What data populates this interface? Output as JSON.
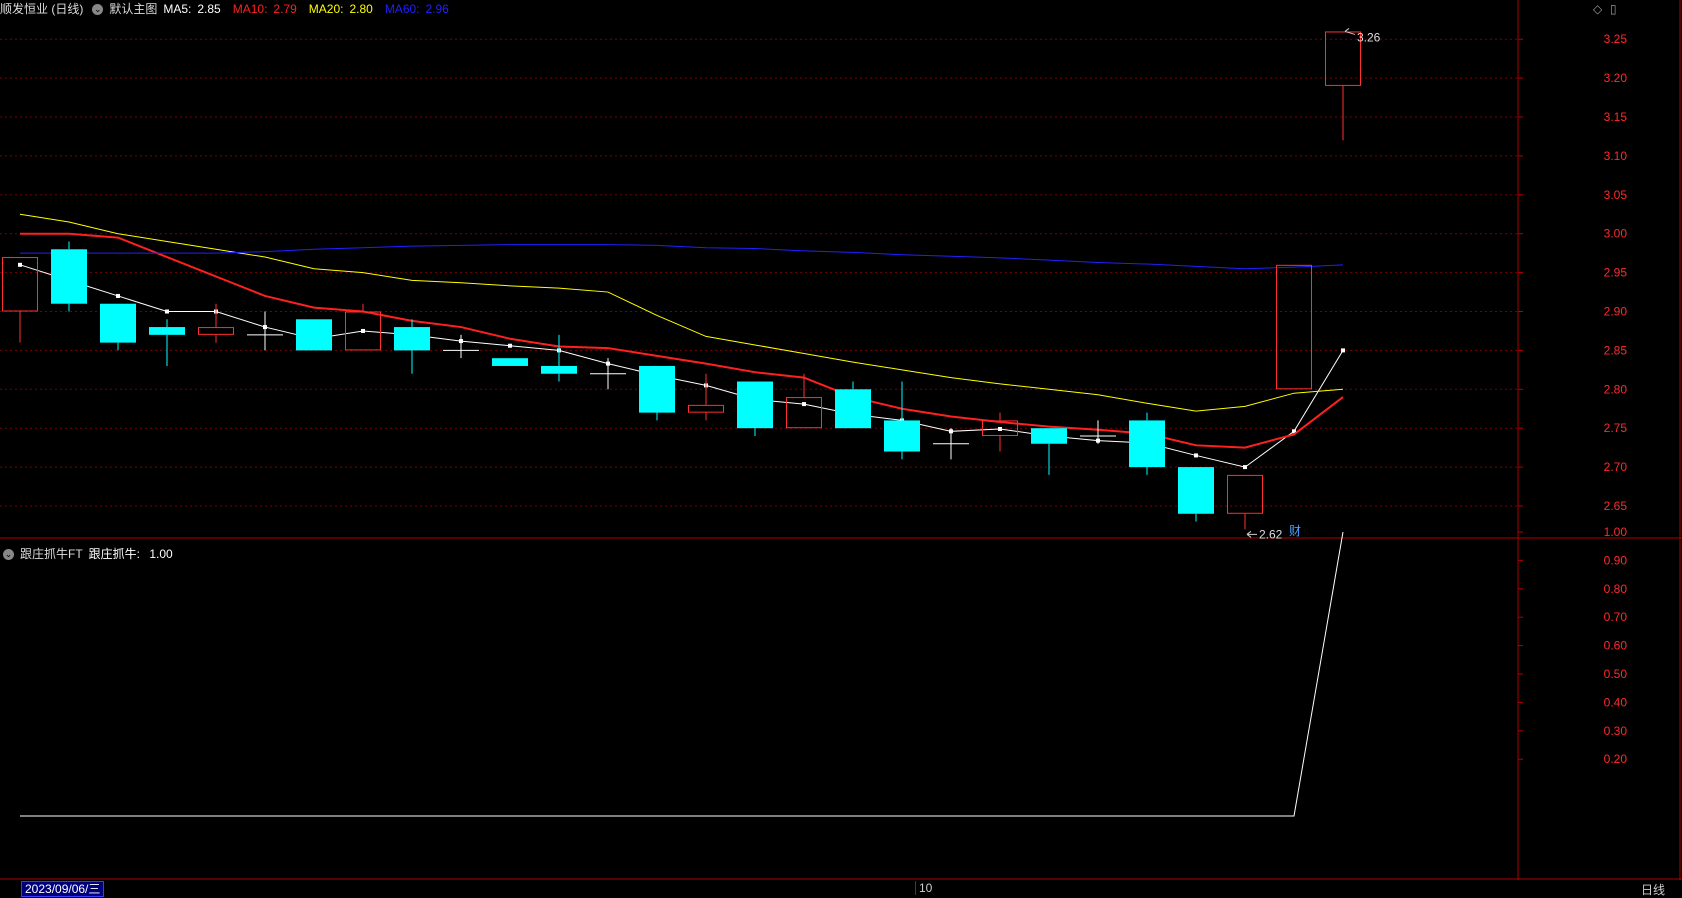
{
  "header": {
    "stock": "顺发恒业 (日线)",
    "main_label": "默认主图",
    "ma": [
      {
        "label": "MA5:",
        "value": "2.85",
        "color": "#ffffff"
      },
      {
        "label": "MA10:",
        "value": "2.79",
        "color": "#ff2020"
      },
      {
        "label": "MA20:",
        "value": "2.80",
        "color": "#ffff00"
      },
      {
        "label": "MA60:",
        "value": "2.96",
        "color": "#2020ff"
      }
    ]
  },
  "sub_header": {
    "indicator": "跟庄抓牛FT",
    "line_label": "跟庄抓牛:",
    "line_value": "1.00"
  },
  "bottom": {
    "date": "2023/09/06/三",
    "month_marker": "10",
    "period": "日线"
  },
  "annotations": {
    "high": "3.26",
    "low": "2.62",
    "fin_marker": "财"
  },
  "chart_data": [
    {
      "type": "candlestick",
      "y_ticks": [
        "3.25",
        "3.20",
        "3.15",
        "3.10",
        "3.05",
        "3.00",
        "2.95",
        "2.90",
        "2.85",
        "2.80",
        "2.75",
        "2.70",
        "2.65"
      ],
      "ylim": [
        2.605,
        3.285
      ],
      "colors": {
        "up": "#ff3030",
        "down": "#00ffff",
        "doji": "#ffffff"
      },
      "candles": [
        [
          2.9,
          2.97,
          2.97,
          2.86
        ],
        [
          2.98,
          2.91,
          2.99,
          2.9
        ],
        [
          2.91,
          2.86,
          2.91,
          2.85
        ],
        [
          2.88,
          2.87,
          2.89,
          2.83
        ],
        [
          2.87,
          2.88,
          2.91,
          2.86
        ],
        [
          2.87,
          2.87,
          2.9,
          2.85
        ],
        [
          2.89,
          2.85,
          2.89,
          2.85
        ],
        [
          2.85,
          2.9,
          2.91,
          2.85
        ],
        [
          2.88,
          2.85,
          2.89,
          2.82
        ],
        [
          2.85,
          2.85,
          2.87,
          2.84
        ],
        [
          2.84,
          2.83,
          2.84,
          2.83
        ],
        [
          2.83,
          2.82,
          2.87,
          2.81
        ],
        [
          2.82,
          2.82,
          2.84,
          2.8
        ],
        [
          2.83,
          2.77,
          2.83,
          2.76
        ],
        [
          2.77,
          2.78,
          2.82,
          2.76
        ],
        [
          2.81,
          2.75,
          2.81,
          2.74
        ],
        [
          2.75,
          2.79,
          2.82,
          2.75
        ],
        [
          2.8,
          2.75,
          2.81,
          2.75
        ],
        [
          2.76,
          2.72,
          2.81,
          2.71
        ],
        [
          2.73,
          2.73,
          2.75,
          2.71
        ],
        [
          2.74,
          2.76,
          2.77,
          2.72
        ],
        [
          2.75,
          2.73,
          2.75,
          2.69
        ],
        [
          2.74,
          2.74,
          2.76,
          2.73
        ],
        [
          2.76,
          2.7,
          2.77,
          2.69
        ],
        [
          2.7,
          2.64,
          2.7,
          2.63
        ],
        [
          2.64,
          2.69,
          2.69,
          2.62
        ],
        [
          2.8,
          2.96,
          2.96,
          2.8
        ],
        [
          3.19,
          3.26,
          3.26,
          3.12
        ]
      ],
      "ma": [
        {
          "name": "MA5",
          "color": "#ffffff",
          "values": [
            2.96,
            2.94,
            2.92,
            2.9,
            2.9,
            2.88,
            2.865,
            2.875,
            2.87,
            2.862,
            2.856,
            2.85,
            2.833,
            2.818,
            2.805,
            2.787,
            2.781,
            2.768,
            2.76,
            2.746,
            2.749,
            2.74,
            2.734,
            2.731,
            2.715,
            2.7,
            2.746,
            2.85
          ]
        },
        {
          "name": "MA10",
          "color": "#ff2020",
          "values": [
            3.0,
            3.0,
            2.995,
            2.97,
            2.945,
            2.92,
            2.905,
            2.9,
            2.888,
            2.88,
            2.865,
            2.855,
            2.853,
            2.843,
            2.833,
            2.822,
            2.815,
            2.79,
            2.775,
            2.765,
            2.758,
            2.752,
            2.748,
            2.743,
            2.728,
            2.725,
            2.742,
            2.79
          ]
        },
        {
          "name": "MA20",
          "color": "#ffff00",
          "values": [
            3.025,
            3.015,
            3.0,
            2.99,
            2.98,
            2.97,
            2.955,
            2.95,
            2.94,
            2.937,
            2.933,
            2.93,
            2.925,
            2.895,
            2.868,
            2.857,
            2.846,
            2.835,
            2.825,
            2.815,
            2.807,
            2.8,
            2.793,
            2.782,
            2.772,
            2.778,
            2.795,
            2.8
          ]
        },
        {
          "name": "MA60",
          "color": "#2020ff",
          "values": [
            2.975,
            2.975,
            2.975,
            2.975,
            2.975,
            2.977,
            2.98,
            2.982,
            2.984,
            2.985,
            2.986,
            2.986,
            2.986,
            2.985,
            2.982,
            2.981,
            2.978,
            2.976,
            2.973,
            2.971,
            2.969,
            2.966,
            2.963,
            2.961,
            2.958,
            2.955,
            2.957,
            2.96
          ]
        }
      ]
    },
    {
      "type": "line",
      "title": "跟庄抓牛FT",
      "series": [
        {
          "name": "跟庄抓牛",
          "color": "#ffffff",
          "values": [
            0,
            0,
            0,
            0,
            0,
            0,
            0,
            0,
            0,
            0,
            0,
            0,
            0,
            0,
            0,
            0,
            0,
            0,
            0,
            0,
            0,
            0,
            0,
            0,
            0,
            0,
            0,
            1.0
          ]
        }
      ],
      "y_ticks": [
        "1.00",
        "0.90",
        "0.80",
        "0.70",
        "0.60",
        "0.50",
        "0.40",
        "0.30",
        "0.20"
      ],
      "ylim": [
        0,
        1.0
      ]
    }
  ]
}
